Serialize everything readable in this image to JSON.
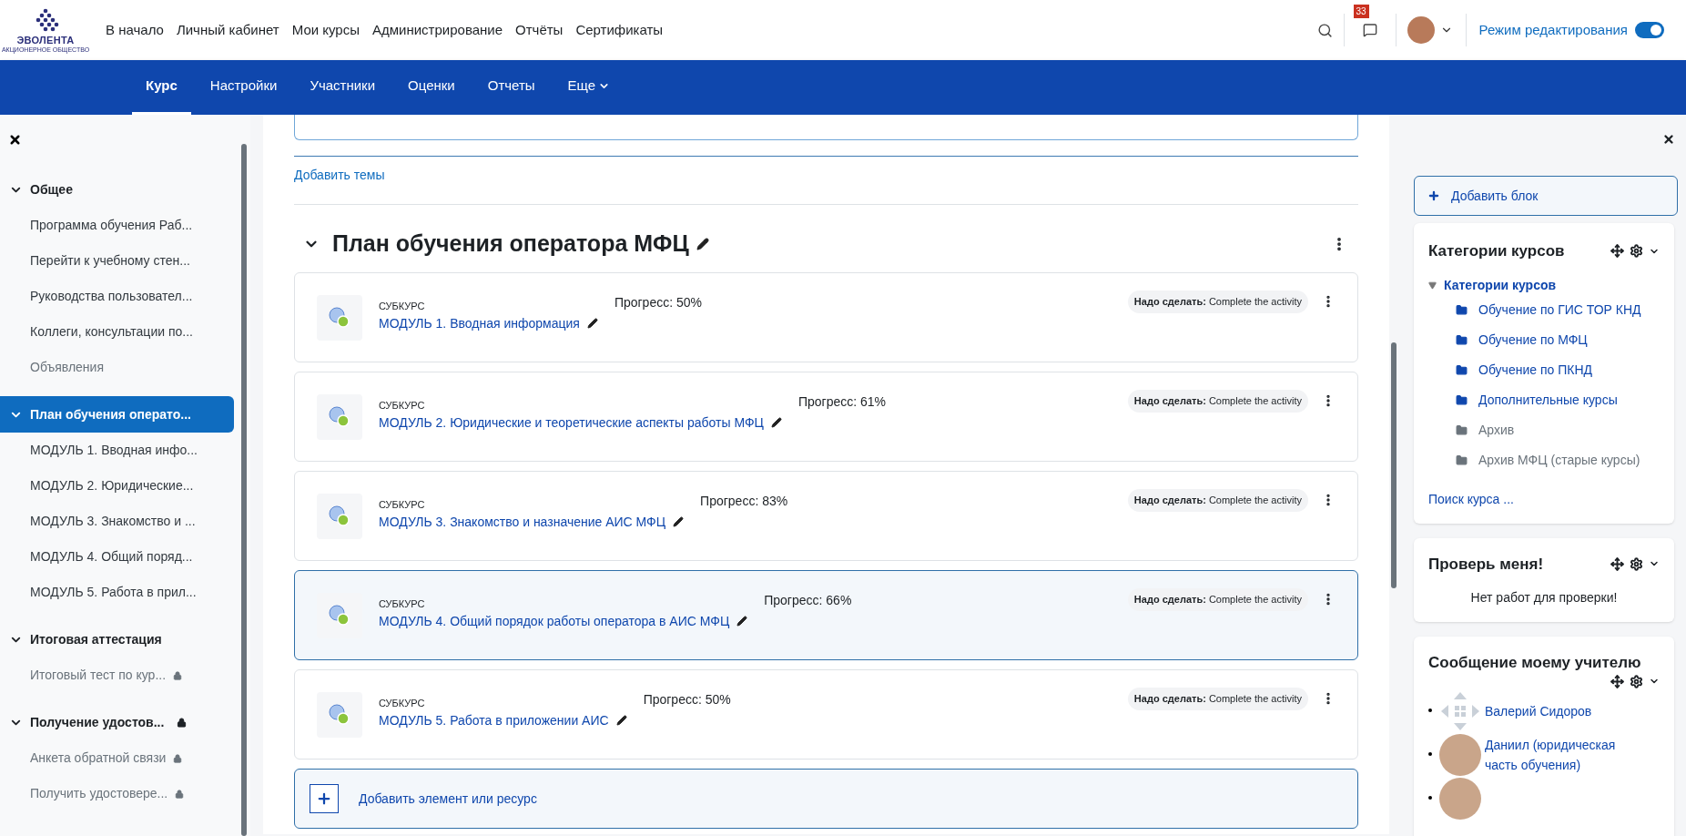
{
  "logo": {
    "name": "ЭВОЛЕНТА",
    "subtitle": "АКЦИОНЕРНОЕ ОБЩЕСТВО"
  },
  "top_nav": [
    {
      "label": "В начало"
    },
    {
      "label": "Личный кабинет"
    },
    {
      "label": "Мои курсы"
    },
    {
      "label": "Администрирование"
    },
    {
      "label": "Отчёты"
    },
    {
      "label": "Сертификаты"
    }
  ],
  "notifications": {
    "count": "33"
  },
  "edit_mode": {
    "label": "Режим редактирования",
    "on": true
  },
  "course_tabs": [
    {
      "label": "Курс",
      "selected": true
    },
    {
      "label": "Настройки",
      "selected": false
    },
    {
      "label": "Участники",
      "selected": false
    },
    {
      "label": "Оценки",
      "selected": false
    },
    {
      "label": "Отчеты",
      "selected": false
    },
    {
      "label": "Еще",
      "selected": false,
      "menu": true
    }
  ],
  "course_index": [
    {
      "label": "Общее",
      "selected": false,
      "locked": false,
      "children": [
        {
          "label": "Программа обучения Раб...",
          "dimmed": false,
          "locked": false
        },
        {
          "label": "Перейти к учебному стен...",
          "dimmed": false,
          "locked": false
        },
        {
          "label": "Руководства пользовател...",
          "dimmed": false,
          "locked": false
        },
        {
          "label": "Коллеги, консультации по...",
          "dimmed": false,
          "locked": false
        },
        {
          "label": "Объявления",
          "dimmed": true,
          "locked": false
        }
      ]
    },
    {
      "label": "План обучения операто...",
      "selected": true,
      "locked": false,
      "children": [
        {
          "label": "МОДУЛЬ 1. Вводная инфо...",
          "dimmed": false,
          "locked": false
        },
        {
          "label": "МОДУЛЬ 2. Юридические...",
          "dimmed": false,
          "locked": false
        },
        {
          "label": "МОДУЛЬ 3. Знакомство и ...",
          "dimmed": false,
          "locked": false
        },
        {
          "label": "МОДУЛЬ 4. Общий поряд...",
          "dimmed": false,
          "locked": false
        },
        {
          "label": "МОДУЛЬ 5. Работа в прил...",
          "dimmed": false,
          "locked": false
        }
      ]
    },
    {
      "label": "Итоговая аттестация",
      "selected": false,
      "locked": false,
      "children": [
        {
          "label": "Итоговый тест по кур...",
          "dimmed": true,
          "locked": true
        }
      ]
    },
    {
      "label": "Получение удостов...",
      "selected": false,
      "locked": true,
      "children": [
        {
          "label": "Анкета обратной связи",
          "dimmed": true,
          "locked": true
        },
        {
          "label": "Получить удостовере...",
          "dimmed": true,
          "locked": true
        }
      ]
    }
  ],
  "main": {
    "add_topics": "Добавить темы",
    "section": {
      "title": "План обучения оператора МФЦ",
      "expanded": true,
      "activities": [
        {
          "type": "СУБКУРС",
          "name": "МОДУЛЬ 1. Вводная информация",
          "progress": "Прогресс: 50%",
          "todo_label": "Надо сделать:",
          "todo": "Complete the activity",
          "highlighted": false
        },
        {
          "type": "СУБКУРС",
          "name": "МОДУЛЬ 2. Юридические и теоретические аспекты работы МФЦ",
          "progress": "Прогресс: 61%",
          "todo_label": "Надо сделать:",
          "todo": "Complete the activity",
          "highlighted": false
        },
        {
          "type": "СУБКУРС",
          "name": "МОДУЛЬ 3. Знакомство и назначение АИС МФЦ",
          "progress": "Прогресс: 83%",
          "todo_label": "Надо сделать:",
          "todo": "Complete the activity",
          "highlighted": false
        },
        {
          "type": "СУБКУРС",
          "name": "МОДУЛЬ 4. Общий порядок работы оператора в АИС МФЦ",
          "progress": "Прогресс: 66%",
          "todo_label": "Надо сделать:",
          "todo": "Complete the activity",
          "highlighted": true
        },
        {
          "type": "СУБКУРС",
          "name": "МОДУЛЬ 5. Работа в приложении АИС",
          "progress": "Прогресс: 50%",
          "todo_label": "Надо сделать:",
          "todo": "Complete the activity",
          "highlighted": false
        }
      ],
      "add_activity": "Добавить элемент или ресурс"
    }
  },
  "blocks_drawer": {
    "add_block": "Добавить блок",
    "categories": {
      "title": "Категории курсов",
      "root": {
        "label": "Категории курсов",
        "expanded": true
      },
      "items": [
        {
          "label": "Обучение по ГИС ТОР КНД",
          "hidden": false
        },
        {
          "label": "Обучение по МФЦ",
          "hidden": false
        },
        {
          "label": "Обучение по ПКНД",
          "hidden": false
        },
        {
          "label": "Дополнительные курсы",
          "hidden": false
        },
        {
          "label": "Архив",
          "hidden": true
        },
        {
          "label": "Архив МФЦ (старые курсы)",
          "hidden": true
        }
      ],
      "search": "Поиск курса ..."
    },
    "check_me": {
      "title": "Проверь меня!",
      "text": "Нет работ для проверки!"
    },
    "message_teacher": {
      "title": "Сообщение моему учителю",
      "teachers": [
        {
          "name": "Валерий Сидоров",
          "kind": "default"
        },
        {
          "name": "Даниил (юридическая часть обучения)",
          "kind": "photo"
        },
        {
          "kind": "photo"
        }
      ]
    }
  }
}
